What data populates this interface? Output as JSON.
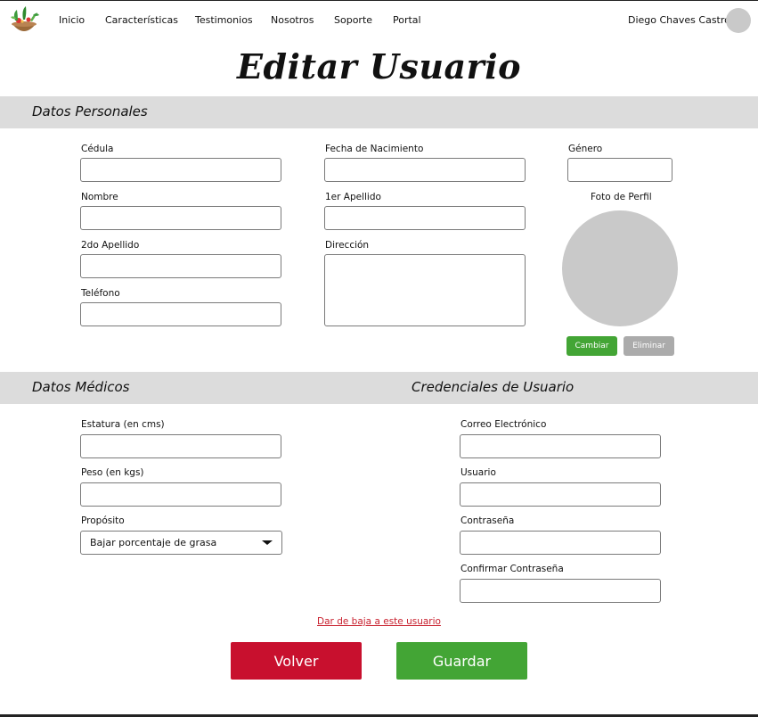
{
  "nav": {
    "items": [
      "Inicio",
      "Características",
      "Testimonios",
      "Nosotros",
      "Soporte",
      "Portal"
    ],
    "user_name": "Diego Chaves Castro"
  },
  "page": {
    "title": "Editar Usuario"
  },
  "personal": {
    "section_title": "Datos Personales",
    "cedula_label": "Cédula",
    "nombre_label": "Nombre",
    "apellido2_label": "2do Apellido",
    "telefono_label": "Teléfono",
    "fecha_label": "Fecha de Nacimiento",
    "apellido1_label": "1er Apellido",
    "direccion_label": "Dirección",
    "genero_label": "Género",
    "foto_label": "Foto de Perfil",
    "change_label": "Cambiar",
    "delete_label": "Eliminar"
  },
  "medical": {
    "section_title": "Datos Médicos",
    "estatura_label": "Estatura (en cms)",
    "peso_label": "Peso (en kgs)",
    "proposito_label": "Propósito",
    "proposito_value": "Bajar porcentaje de grasa"
  },
  "credentials": {
    "section_title": "Credenciales de Usuario",
    "correo_label": "Correo Electrónico",
    "usuario_label": "Usuario",
    "password_label": "Contraseña",
    "confirm_label": "Confirmar Contraseña"
  },
  "actions": {
    "unsubscribe_label": "Dar de baja a este usuario",
    "back_label": "Volver",
    "save_label": "Guardar"
  },
  "colors": {
    "green": "#43a535",
    "red": "#c8102e",
    "gray_button": "#ababab",
    "section_bg": "#dcdcdc"
  }
}
